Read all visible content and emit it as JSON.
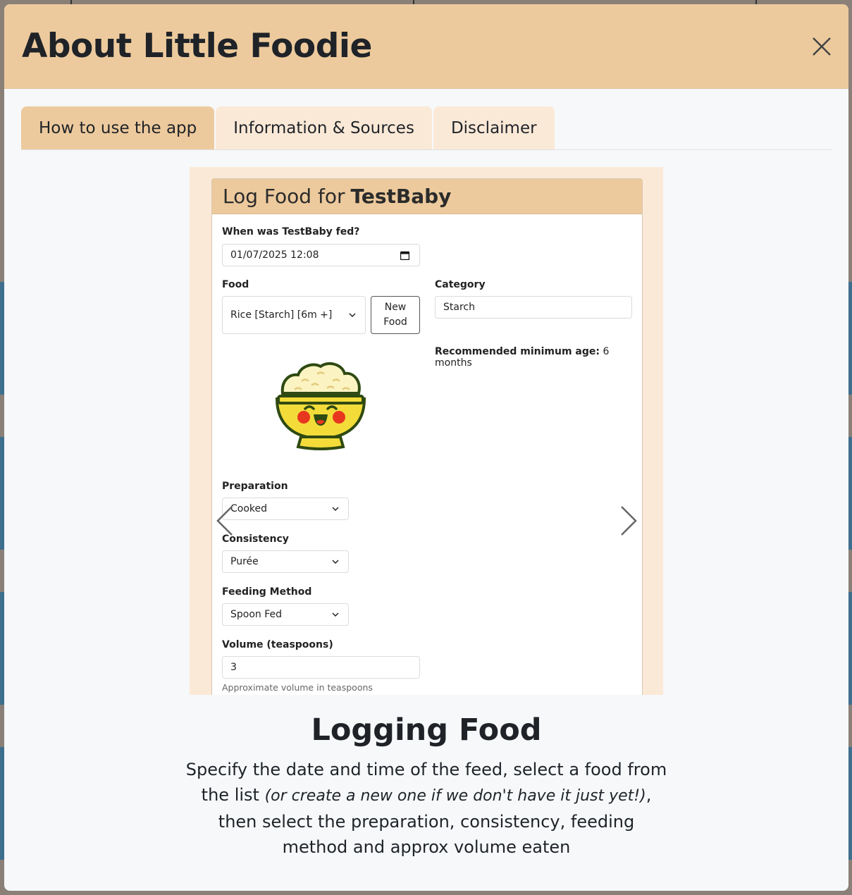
{
  "modal": {
    "title": "About Little Foodie"
  },
  "tabs": [
    {
      "label": "How to use the app",
      "active": true
    },
    {
      "label": "Information & Sources",
      "active": false
    },
    {
      "label": "Disclaimer",
      "active": false
    }
  ],
  "slide": {
    "card_title_prefix": "Log Food for",
    "card_title_name": "TestBaby",
    "when_label": "When was TestBaby fed?",
    "when_value": "01/07/2025 12:08",
    "food_label": "Food",
    "food_value": "Rice [Starch] [6m +]",
    "new_food_line1": "New",
    "new_food_line2": "Food",
    "category_label": "Category",
    "category_value": "Starch",
    "rec_label": "Recommended minimum age:",
    "rec_value": "6 months",
    "preparation_label": "Preparation",
    "preparation_value": "Cooked",
    "consistency_label": "Consistency",
    "consistency_value": "Purée",
    "method_label": "Feeding Method",
    "method_value": "Spoon Fed",
    "volume_label": "Volume (teaspoons)",
    "volume_value": "3",
    "volume_hint": "Approximate volume in teaspoons"
  },
  "caption": {
    "title": "Logging Food",
    "text_before": "Specify the date and time of the feed, select a food from the list ",
    "text_italic": "(or create a new one if we don't have it just yet!)",
    "text_after": ", then select the preparation, consistency, feeding method and approx volume eaten"
  },
  "colors": {
    "header_bg": "#edca9d",
    "tab_inactive_bg": "#fbe9d7",
    "modal_bg": "#f6f8fa"
  },
  "icons": [
    "close-icon",
    "calendar-icon",
    "chevron-down-icon",
    "chevron-left-icon",
    "chevron-right-icon",
    "rice-bowl-icon"
  ]
}
